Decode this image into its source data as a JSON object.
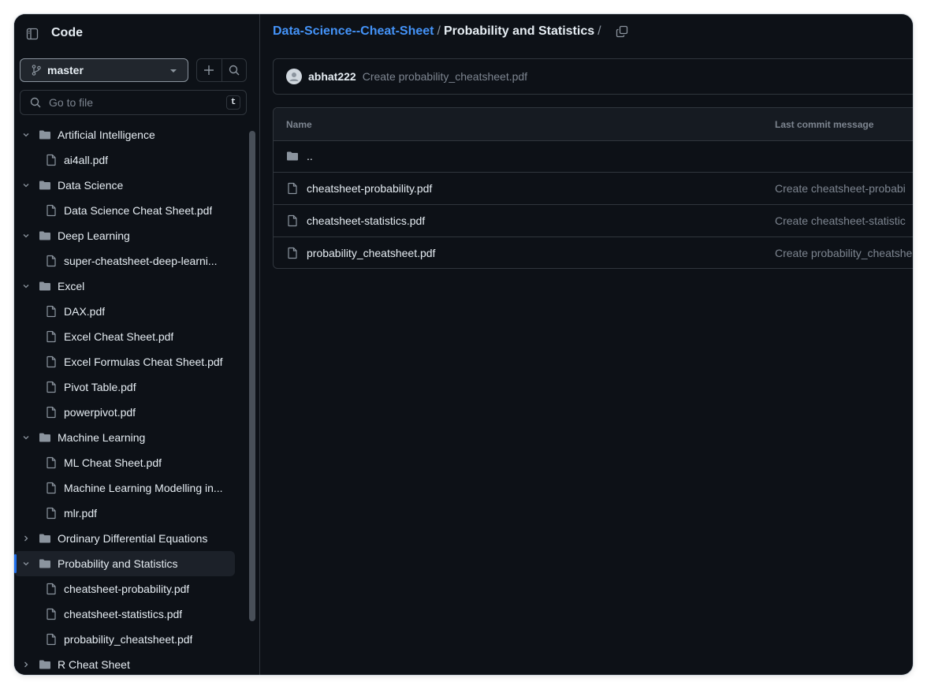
{
  "sidebar": {
    "title": "Code",
    "branch": "master",
    "search_placeholder": "Go to file",
    "search_shortcut": "t",
    "tree": [
      {
        "type": "folder",
        "label": "Artificial Intelligence",
        "expanded": true
      },
      {
        "type": "file",
        "label": "ai4all.pdf"
      },
      {
        "type": "folder",
        "label": "Data Science",
        "expanded": true
      },
      {
        "type": "file",
        "label": "Data Science Cheat Sheet.pdf"
      },
      {
        "type": "folder",
        "label": "Deep Learning",
        "expanded": true
      },
      {
        "type": "file",
        "label": "super-cheatsheet-deep-learni..."
      },
      {
        "type": "folder",
        "label": "Excel",
        "expanded": true
      },
      {
        "type": "file",
        "label": "DAX.pdf"
      },
      {
        "type": "file",
        "label": "Excel Cheat Sheet.pdf"
      },
      {
        "type": "file",
        "label": "Excel Formulas Cheat Sheet.pdf"
      },
      {
        "type": "file",
        "label": "Pivot Table.pdf"
      },
      {
        "type": "file",
        "label": "powerpivot.pdf"
      },
      {
        "type": "folder",
        "label": "Machine Learning",
        "expanded": true
      },
      {
        "type": "file",
        "label": "ML Cheat Sheet.pdf"
      },
      {
        "type": "file",
        "label": "Machine Learning Modelling in..."
      },
      {
        "type": "file",
        "label": "mlr.pdf"
      },
      {
        "type": "folder",
        "label": "Ordinary Differential Equations",
        "expanded": false
      },
      {
        "type": "folder",
        "label": "Probability and Statistics",
        "expanded": true,
        "active": true
      },
      {
        "type": "file",
        "label": "cheatsheet-probability.pdf"
      },
      {
        "type": "file",
        "label": "cheatsheet-statistics.pdf"
      },
      {
        "type": "file",
        "label": "probability_cheatsheet.pdf"
      },
      {
        "type": "folder",
        "label": "R Cheat Sheet",
        "expanded": false
      }
    ]
  },
  "breadcrumb": {
    "repo": "Data-Science--Cheat-Sheet",
    "separator": "/",
    "current": "Probability and Statistics"
  },
  "latest_commit": {
    "author": "abhat222",
    "message": "Create probability_cheatsheet.pdf"
  },
  "file_table": {
    "headers": {
      "name": "Name",
      "last_commit": "Last commit message"
    },
    "rows": [
      {
        "type": "folder",
        "name": "..",
        "message": ""
      },
      {
        "type": "file",
        "name": "cheatsheet-probability.pdf",
        "message": "Create cheatsheet-probabi"
      },
      {
        "type": "file",
        "name": "cheatsheet-statistics.pdf",
        "message": "Create cheatsheet-statistic"
      },
      {
        "type": "file",
        "name": "probability_cheatsheet.pdf",
        "message": "Create probability_cheatshe"
      }
    ]
  },
  "colors": {
    "background": "#0d1117",
    "border": "#30363d",
    "link": "#4493f8",
    "text": "#e6edf3",
    "muted": "#7d8590",
    "active_indicator": "#1f6feb"
  }
}
